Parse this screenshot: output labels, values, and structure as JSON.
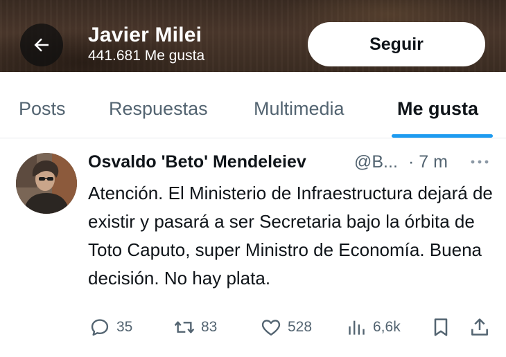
{
  "header": {
    "profile_name": "Javier Milei",
    "likes_count": "441.681 Me gusta",
    "follow_label": "Seguir",
    "back_icon": "arrow-left-icon"
  },
  "tabs": [
    {
      "label": "Posts",
      "active": false
    },
    {
      "label": "Respuestas",
      "active": false
    },
    {
      "label": "Multimedia",
      "active": false
    },
    {
      "label": "Me gusta",
      "active": true
    }
  ],
  "tweet": {
    "author_name": "Osvaldo 'Beto' Mendeleiev",
    "author_handle": "@B...",
    "time": "· 7 m",
    "text": "Atención. El Ministerio de Infraestructura dejará de existir y pasará a ser Secretaria bajo la órbita de Toto Caputo, super Ministro de Economía. Buena decisión. No hay plata.",
    "actions": {
      "replies": "35",
      "reposts": "83",
      "likes": "528",
      "views": "6,6k"
    }
  },
  "colors": {
    "accent": "#1d9bf0",
    "text_primary": "#0f1419",
    "text_secondary": "#536471"
  }
}
